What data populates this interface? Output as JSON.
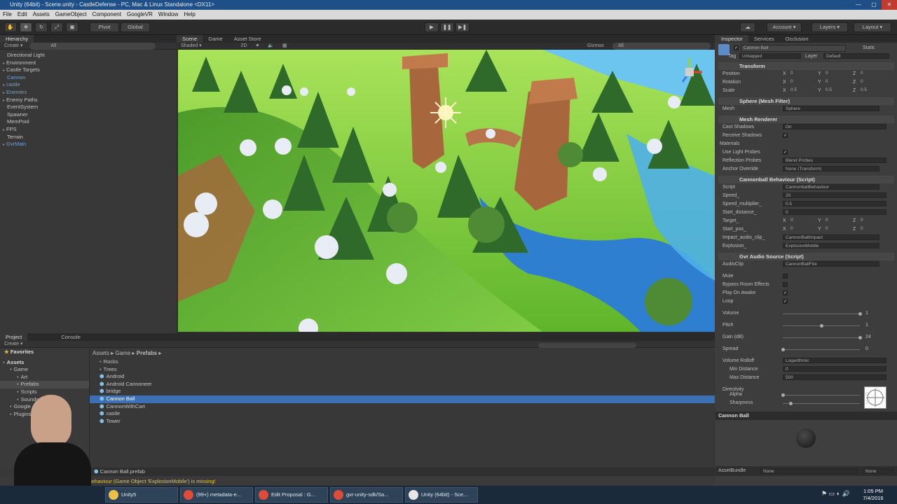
{
  "window": {
    "title": "Unity (64bit) - Scene.unity - CastleDefense - PC, Mac & Linux Standalone <DX11>"
  },
  "menu": [
    "File",
    "Edit",
    "Assets",
    "GameObject",
    "Component",
    "GoogleVR",
    "Window",
    "Help"
  ],
  "toolbar": {
    "pivot": "Pivot",
    "global": "Global",
    "account": "Account",
    "layers": "Layers",
    "layout": "Layout"
  },
  "hierarchy": {
    "tab": "Hierarchy",
    "create": "Create",
    "search": "All",
    "items": [
      {
        "label": "Directional Light",
        "color": "normal"
      },
      {
        "label": "Environment",
        "color": "normal",
        "arrow": true
      },
      {
        "label": "Castle Targets",
        "color": "normal",
        "arrow": true
      },
      {
        "label": "Cannon",
        "color": "blue"
      },
      {
        "label": "castle",
        "color": "blue",
        "arrow": true
      },
      {
        "label": "Enemies",
        "color": "blue",
        "arrow": true
      },
      {
        "label": "Enemy Paths",
        "color": "normal",
        "arrow": true
      },
      {
        "label": "EventSystem",
        "color": "normal"
      },
      {
        "label": "Spawner",
        "color": "normal"
      },
      {
        "label": "MemPool",
        "color": "normal"
      },
      {
        "label": "FPS",
        "color": "normal",
        "arrow": true
      },
      {
        "label": "Terrain",
        "color": "normal"
      },
      {
        "label": "GvrMain",
        "color": "blue",
        "arrow": true
      }
    ]
  },
  "scene": {
    "tabs": [
      "Scene",
      "Game",
      "Asset Store"
    ],
    "shading": "Shaded",
    "mode": "2D",
    "gizmos": "Gizmos",
    "search": "All"
  },
  "inspector": {
    "tabs": [
      "Inspector",
      "Services",
      "Occlusion"
    ],
    "object_name": "Cannon Ball",
    "static": "Static",
    "tag_label": "Tag",
    "tag": "Untagged",
    "layer_label": "Layer",
    "layer": "Default",
    "transform": {
      "title": "Transform",
      "position_label": "Position",
      "rotation_label": "Rotation",
      "scale_label": "Scale",
      "position": [
        "0",
        "0",
        "0"
      ],
      "rotation": [
        "0",
        "0",
        "0"
      ],
      "scale": [
        "0.5",
        "0.5",
        "0.5"
      ]
    },
    "axes": [
      "X",
      "Y",
      "Z"
    ],
    "mesh_filter": {
      "title": "Sphere (Mesh Filter)",
      "mesh_label": "Mesh",
      "mesh": "Sphere"
    },
    "mesh_renderer": {
      "title": "Mesh Renderer",
      "cast_shadows_label": "Cast Shadows",
      "cast_shadows": "On",
      "receive_shadows_label": "Receive Shadows",
      "materials_label": "Materials",
      "light_probes_label": "Use Light Probes",
      "reflection_label": "Reflection Probes",
      "reflection": "Blend Probes",
      "anchor_label": "Anchor Override",
      "anchor": "None (Transform)"
    },
    "cannonball": {
      "title": "Cannonball Behaviour (Script)",
      "script_label": "Script",
      "script": "CannonballBehaviour",
      "speed_label": "Speed_",
      "speed": "20",
      "speed_mult_label": "Speed_multiplier_",
      "speed_mult": "0.5",
      "start_dist_label": "Start_distance_",
      "start_dist": "0",
      "target_label": "Target_",
      "start_pos_label": "Start_pos_",
      "target": [
        "0",
        "0",
        "0"
      ],
      "start_pos": [
        "0",
        "0",
        "0"
      ],
      "impact_label": "Impact_audio_clip_",
      "impact": "CannonBallImpact",
      "explosion_label": "Explosion_",
      "explosion": "ExplosionMobile"
    },
    "audio": {
      "title": "Gvr Audio Source (Script)",
      "clip_label": "AudioClip",
      "clip": "CannonBallFire",
      "mute_label": "Mute",
      "bypass_label": "Bypass Room Effects",
      "play_label": "Play On Awake",
      "loop_label": "Loop",
      "volume_label": "Volume",
      "volume": "1",
      "volume_level": 1.0,
      "pitch_label": "Pitch",
      "pitch": "1",
      "pitch_level": 0.5,
      "gain_label": "Gain (dB)",
      "gain": "24",
      "gain_level": 1.0,
      "spread_label": "Spread",
      "spread": "0",
      "spread_level": 0.0,
      "rolloff_label": "Volume Rolloff",
      "rolloff": "Logarithmic",
      "min_label": "Min Distance",
      "min": "0",
      "max_label": "Max Distance",
      "max": "500",
      "directivity_label": "Directivity",
      "alpha_label": "Alpha",
      "alpha": "0",
      "alpha_level": 0.0,
      "sharpness_label": "Sharpness",
      "sharpness": "1",
      "sharpness_level": 0.1
    },
    "preview_title": "Cannon Ball",
    "assetbundle_label": "AssetBundle",
    "assetbundle": "None",
    "variant": "None"
  },
  "project": {
    "tabs": [
      "Project",
      "Console"
    ],
    "create": "Create",
    "breadcrumb": [
      "Assets",
      "Game",
      "Prefabs"
    ],
    "favorites": "Favorites",
    "tree": [
      {
        "label": "Assets",
        "level": 0,
        "bold": true
      },
      {
        "label": "Game",
        "level": 1
      },
      {
        "label": "Art",
        "level": 2
      },
      {
        "label": "Prefabs",
        "level": 2,
        "selected": true
      },
      {
        "label": "Scripts",
        "level": 2
      },
      {
        "label": "Sounds",
        "level": 2
      },
      {
        "label": "Google",
        "level": 1
      },
      {
        "label": "Plugins",
        "level": 1
      }
    ],
    "files": [
      {
        "label": "Rocks",
        "folder": true
      },
      {
        "label": "Trees",
        "folder": true
      },
      {
        "label": "Android"
      },
      {
        "label": "Android Cannoneer"
      },
      {
        "label": "bridge"
      },
      {
        "label": "Cannon Ball",
        "selected": true
      },
      {
        "label": "CannonWithCart"
      },
      {
        "label": "castle"
      },
      {
        "label": "Tower"
      }
    ],
    "selected_file": "Cannon Ball.prefab"
  },
  "status": {
    "message": "Behaviour (Game Object 'ExplosionMobile') is missing!"
  },
  "taskbar": {
    "items": [
      "Unity5",
      "(99+) metadata-e...",
      "Edit Proposal : G...",
      "gvr-unity-sdk/Sa...",
      "Unity (64bit) - Sce..."
    ],
    "time": "1:05 PM",
    "date": "7/4/2016"
  },
  "colors": {
    "selection": "#3d6fb5",
    "sky": "#6cc5ef",
    "grass": "#7fcf3e",
    "water": "#2e7fd0"
  }
}
